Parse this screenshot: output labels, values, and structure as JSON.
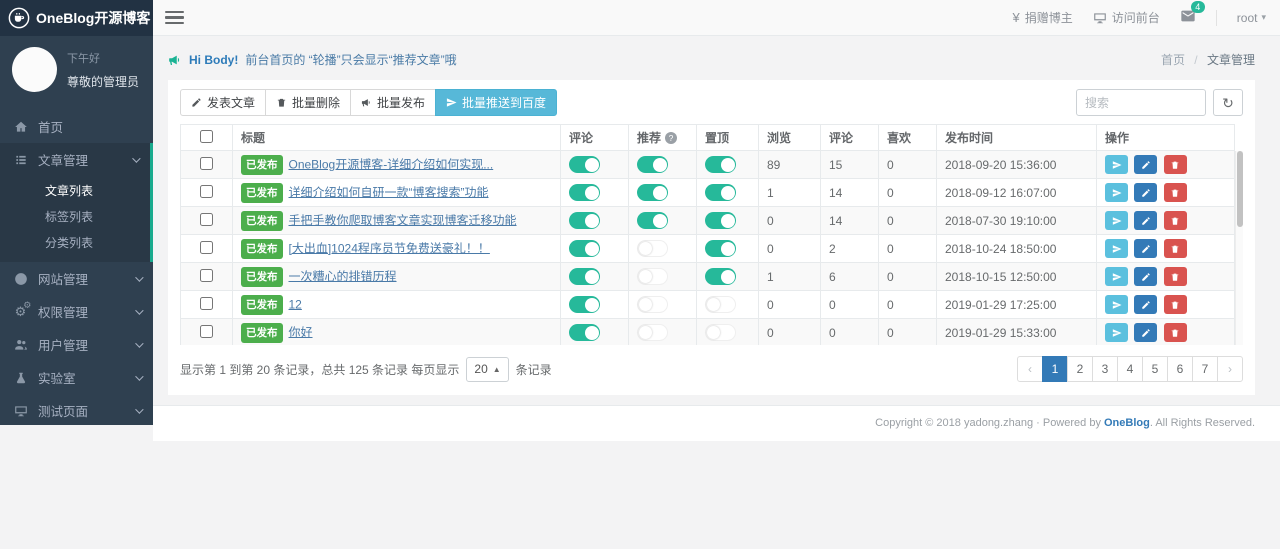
{
  "app": {
    "logo": "OneBlog开源博客"
  },
  "topbar": {
    "donate": "捐赠博主",
    "visit": "访问前台",
    "messages_badge": "4",
    "user": "root"
  },
  "profile": {
    "greeting": "下午好",
    "role": "尊敬的管理员"
  },
  "sidebar": [
    {
      "label": "首页",
      "icon": "home-icon"
    },
    {
      "label": "文章管理",
      "icon": "list-icon",
      "expanded": true,
      "children": [
        {
          "label": "文章列表",
          "active": true
        },
        {
          "label": "标签列表",
          "active": false
        },
        {
          "label": "分类列表",
          "active": false
        }
      ]
    },
    {
      "label": "网站管理",
      "icon": "globe-icon"
    },
    {
      "label": "权限管理",
      "icon": "gears-icon"
    },
    {
      "label": "用户管理",
      "icon": "users-icon"
    },
    {
      "label": "实验室",
      "icon": "flask-icon"
    },
    {
      "label": "测试页面",
      "icon": "desktop-icon"
    }
  ],
  "announcement": {
    "highlight": "Hi Body!",
    "message": "前台首页的 “轮播”只会显示“推荐文章”哦"
  },
  "breadcrumb": {
    "home": "首页",
    "sep": "/",
    "current": "文章管理"
  },
  "toolbar": {
    "publish": "发表文章",
    "batch_delete": "批量删除",
    "batch_publish": "批量发布",
    "batch_push_baidu": "批量推送到百度",
    "search_placeholder": "搜索"
  },
  "table": {
    "headers": {
      "title": "标题",
      "comment": "评论",
      "recommend": "推荐",
      "top": "置顶",
      "views": "浏览",
      "comments": "评论",
      "likes": "喜欢",
      "publish_time": "发布时间",
      "actions": "操作"
    },
    "status_published": "已发布",
    "rows": [
      {
        "title": "OneBlog开源博客-详细介绍如何实现...",
        "comment_on": true,
        "recommend_on": true,
        "top_on": true,
        "views": "89",
        "comments": "15",
        "likes": "0",
        "date": "2018-09-20 15:36:00"
      },
      {
        "title": "详细介绍如何自研一款“博客搜索”功能",
        "comment_on": true,
        "recommend_on": true,
        "top_on": true,
        "views": "1",
        "comments": "14",
        "likes": "0",
        "date": "2018-09-12 16:07:00"
      },
      {
        "title": "手把手教你爬取博客文章实现博客迁移功能",
        "comment_on": true,
        "recommend_on": true,
        "top_on": true,
        "views": "0",
        "comments": "14",
        "likes": "0",
        "date": "2018-07-30 19:10:00"
      },
      {
        "title": "[大出血]1024程序员节免费送豪礼！！",
        "comment_on": true,
        "recommend_on": false,
        "top_on": true,
        "views": "0",
        "comments": "2",
        "likes": "0",
        "date": "2018-10-24 18:50:00"
      },
      {
        "title": "一次糟心的排错历程",
        "comment_on": true,
        "recommend_on": false,
        "top_on": true,
        "views": "1",
        "comments": "6",
        "likes": "0",
        "date": "2018-10-15 12:50:00"
      },
      {
        "title": "12",
        "comment_on": true,
        "recommend_on": false,
        "top_on": false,
        "views": "0",
        "comments": "0",
        "likes": "0",
        "date": "2019-01-29 17:25:00"
      },
      {
        "title": "你好",
        "comment_on": true,
        "recommend_on": false,
        "top_on": false,
        "views": "0",
        "comments": "0",
        "likes": "0",
        "date": "2019-01-29 15:33:00"
      }
    ]
  },
  "pagination": {
    "info_before": "显示第 1 到第 20 条记录，总共 125 条记录 每页显示",
    "page_size": "20",
    "info_after": "条记录",
    "prev": "‹",
    "next": "›",
    "pages": [
      "1",
      "2",
      "3",
      "4",
      "5",
      "6",
      "7"
    ],
    "active": "1"
  },
  "footer": {
    "text_prefix": "Copyright © 2018 yadong.zhang · Powered by ",
    "brand": "OneBlog",
    "text_suffix": ". All Rights Reserved."
  },
  "icons": {
    "yen": "¥",
    "caret_down": "▾",
    "refresh": "↻",
    "help": "?",
    "size_caret": "▲"
  },
  "colors": {
    "accent_teal": "#26b99a",
    "success_green": "#4cae4c",
    "primary_blue": "#337ab7",
    "info_blue": "#5bc0de",
    "danger_red": "#d9534f",
    "sidebar_bg": "#2f4050"
  }
}
